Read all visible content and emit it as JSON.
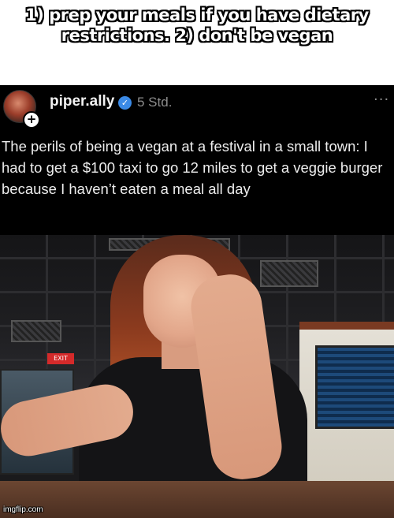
{
  "meme": {
    "caption_line1": "1) prep your meals if you have dietary",
    "caption_line2": "restrictions. 2) don't be vegan",
    "watermark": "imgflip.com"
  },
  "post": {
    "username": "piper.ally",
    "verified_icon": "verified-badge-icon",
    "timestamp": "5 Std.",
    "more_icon_glyph": "···",
    "text": "The perils of being a vegan at a festival in a small town: I had to get a $100 taxi to go 12 miles to get a veggie burger because I haven’t eaten a meal all day",
    "avatar_badge": "+",
    "colors": {
      "background": "#000000",
      "text": "#ededed",
      "meta": "#8c8c8c",
      "verified": "#3b8ae6"
    }
  },
  "photo": {
    "exit_sign": "EXIT"
  }
}
